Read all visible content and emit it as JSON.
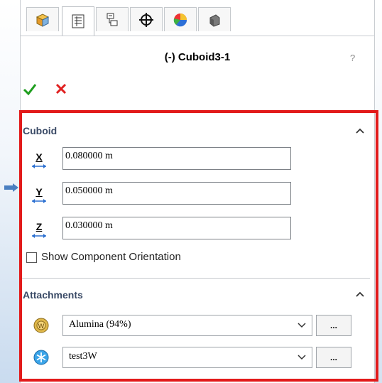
{
  "header": {
    "tabs": [
      {
        "name": "feature-manager",
        "icon": "cube-feature-icon"
      },
      {
        "name": "property-manager",
        "icon": "property-sheet-icon",
        "active": true
      },
      {
        "name": "configuration-manager",
        "icon": "configuration-tree-icon"
      },
      {
        "name": "dimxpert-manager",
        "icon": "crosshair-icon"
      },
      {
        "name": "display-manager",
        "icon": "appearance-sphere-icon"
      },
      {
        "name": "extra-tab",
        "icon": "component-icon"
      }
    ],
    "title": "(-) Cuboid3-1",
    "help_label": "?"
  },
  "actions": {
    "ok_icon": "check-icon",
    "cancel_icon": "close-icon"
  },
  "cuboid": {
    "group_title": "Cuboid",
    "x": {
      "label": "X",
      "value": "0.080000 m"
    },
    "y": {
      "label": "Y",
      "value": "0.050000 m"
    },
    "z": {
      "label": "Z",
      "value": "0.030000 m"
    },
    "show_orientation_label": "Show Component Orientation",
    "show_orientation_checked": false
  },
  "attachments": {
    "group_title": "Attachments",
    "material": {
      "value": "Alumina (94%)",
      "more_label": "..."
    },
    "heat": {
      "value": "test3W",
      "more_label": "..."
    }
  },
  "colors": {
    "highlight": "#e21a1a",
    "ok": "#1e9e1e",
    "cancel": "#e02020"
  }
}
